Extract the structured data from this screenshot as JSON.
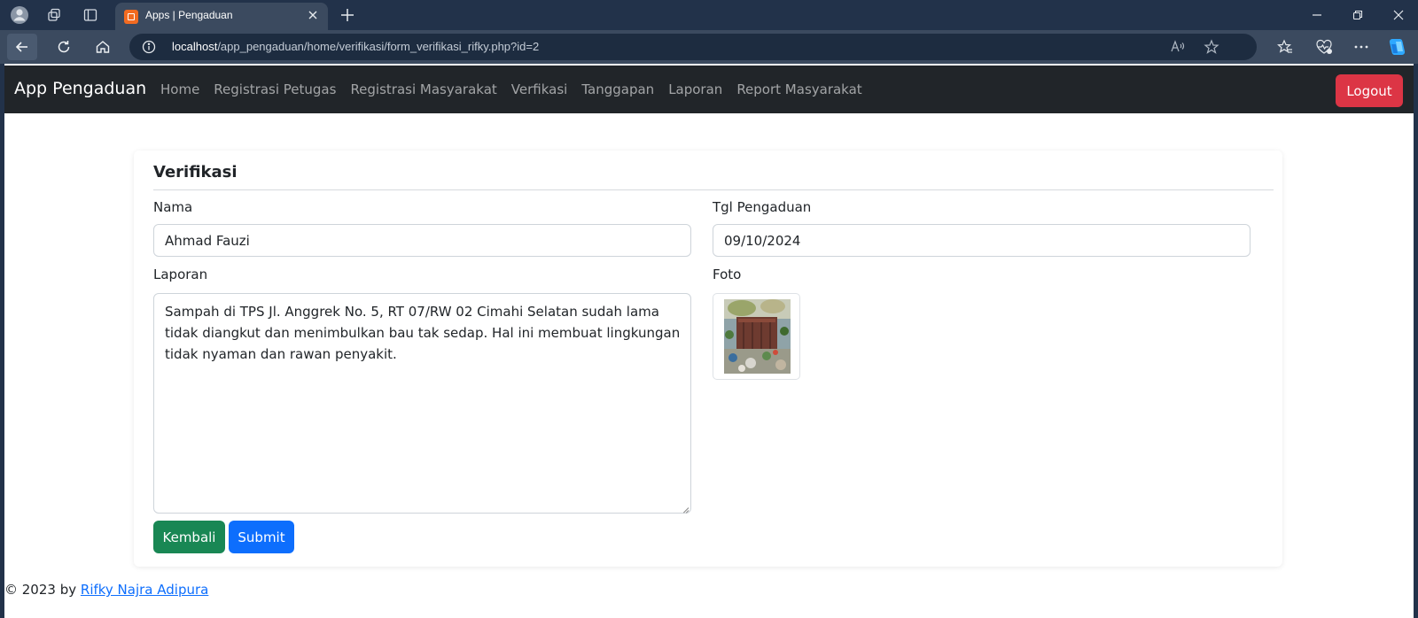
{
  "browser": {
    "tab_title": "Apps | Pengaduan",
    "url_host": "localhost",
    "url_path": "/app_pengaduan/home/verifikasi/form_verifikasi_rifky.php?id=2",
    "icons": {
      "profile": "profile-icon",
      "workspaces": "workspaces-icon",
      "tab_actions": "tab-actions-icon",
      "favicon": "xampp-favicon",
      "close_tab": "close-icon",
      "new_tab": "plus-icon",
      "minimize": "minimize-icon",
      "restore": "restore-icon",
      "close_window": "close-icon",
      "back": "back-arrow-icon",
      "refresh": "refresh-icon",
      "home": "home-icon",
      "site_info": "info-icon",
      "read_aloud": "read-aloud-icon",
      "favorite": "star-icon",
      "favorites": "favorites-icon",
      "browser_essentials": "heart-pulse-icon",
      "more": "more-icon",
      "copilot": "copilot-icon"
    }
  },
  "navbar": {
    "brand": "App Pengaduan",
    "links": [
      "Home",
      "Registrasi Petugas",
      "Registrasi Masyarakat",
      "Verfikasi",
      "Tanggapan",
      "Laporan",
      "Report Masyarakat"
    ],
    "logout_label": "Logout"
  },
  "form": {
    "title": "Verifikasi",
    "nama_label": "Nama",
    "nama_value": "Ahmad Fauzi",
    "tgl_label": "Tgl Pengaduan",
    "tgl_value": "09/10/2024",
    "laporan_label": "Laporan",
    "laporan_value": "Sampah di TPS Jl. Anggrek No. 5, RT 07/RW 02 Cimahi Selatan sudah lama tidak diangkut dan menimbulkan bau tak sedap. Hal ini membuat lingkungan tidak nyaman dan rawan penyakit.",
    "foto_label": "Foto",
    "back_label": "Kembali",
    "submit_label": "Submit"
  },
  "footer": {
    "prefix": "© 2023 by ",
    "author": "Rifky Najra Adipura"
  },
  "colors": {
    "navbar_bg": "#212529",
    "danger": "#dc3545",
    "success": "#198754",
    "primary": "#0d6efd",
    "chrome_bg": "#22324a"
  }
}
